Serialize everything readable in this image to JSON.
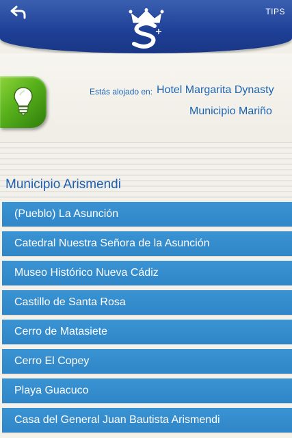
{
  "header": {
    "back_icon": "back-arrow-icon",
    "logo_icon": "crown-s-logo-icon",
    "tips_label": "TIPS",
    "colors": {
      "bar": "#1e3f96"
    }
  },
  "stay": {
    "label": "Estás alojado en:",
    "hotel": "Hotel Margarita Dynasty",
    "municipio": "Municipio Mariño",
    "tips_icon": "lightbulb-icon",
    "colors": {
      "text": "#1e63b0",
      "button": "#56b01a"
    }
  },
  "section": {
    "title": "Municipio Arismendi"
  },
  "places": [
    {
      "label": "(Pueblo) La Asunción"
    },
    {
      "label": "Catedral Nuestra Señora de la Asunción"
    },
    {
      "label": "Museo Histórico Nueva Cádiz"
    },
    {
      "label": "Castillo de Santa Rosa"
    },
    {
      "label": "Cerro de Matasiete"
    },
    {
      "label": "Cerro El Copey"
    },
    {
      "label": "Playa Guacuco"
    },
    {
      "label": "Casa del General Juan Bautista Arismendi"
    }
  ],
  "list_colors": {
    "item": "#2f86c8",
    "text": "#ffffff"
  }
}
